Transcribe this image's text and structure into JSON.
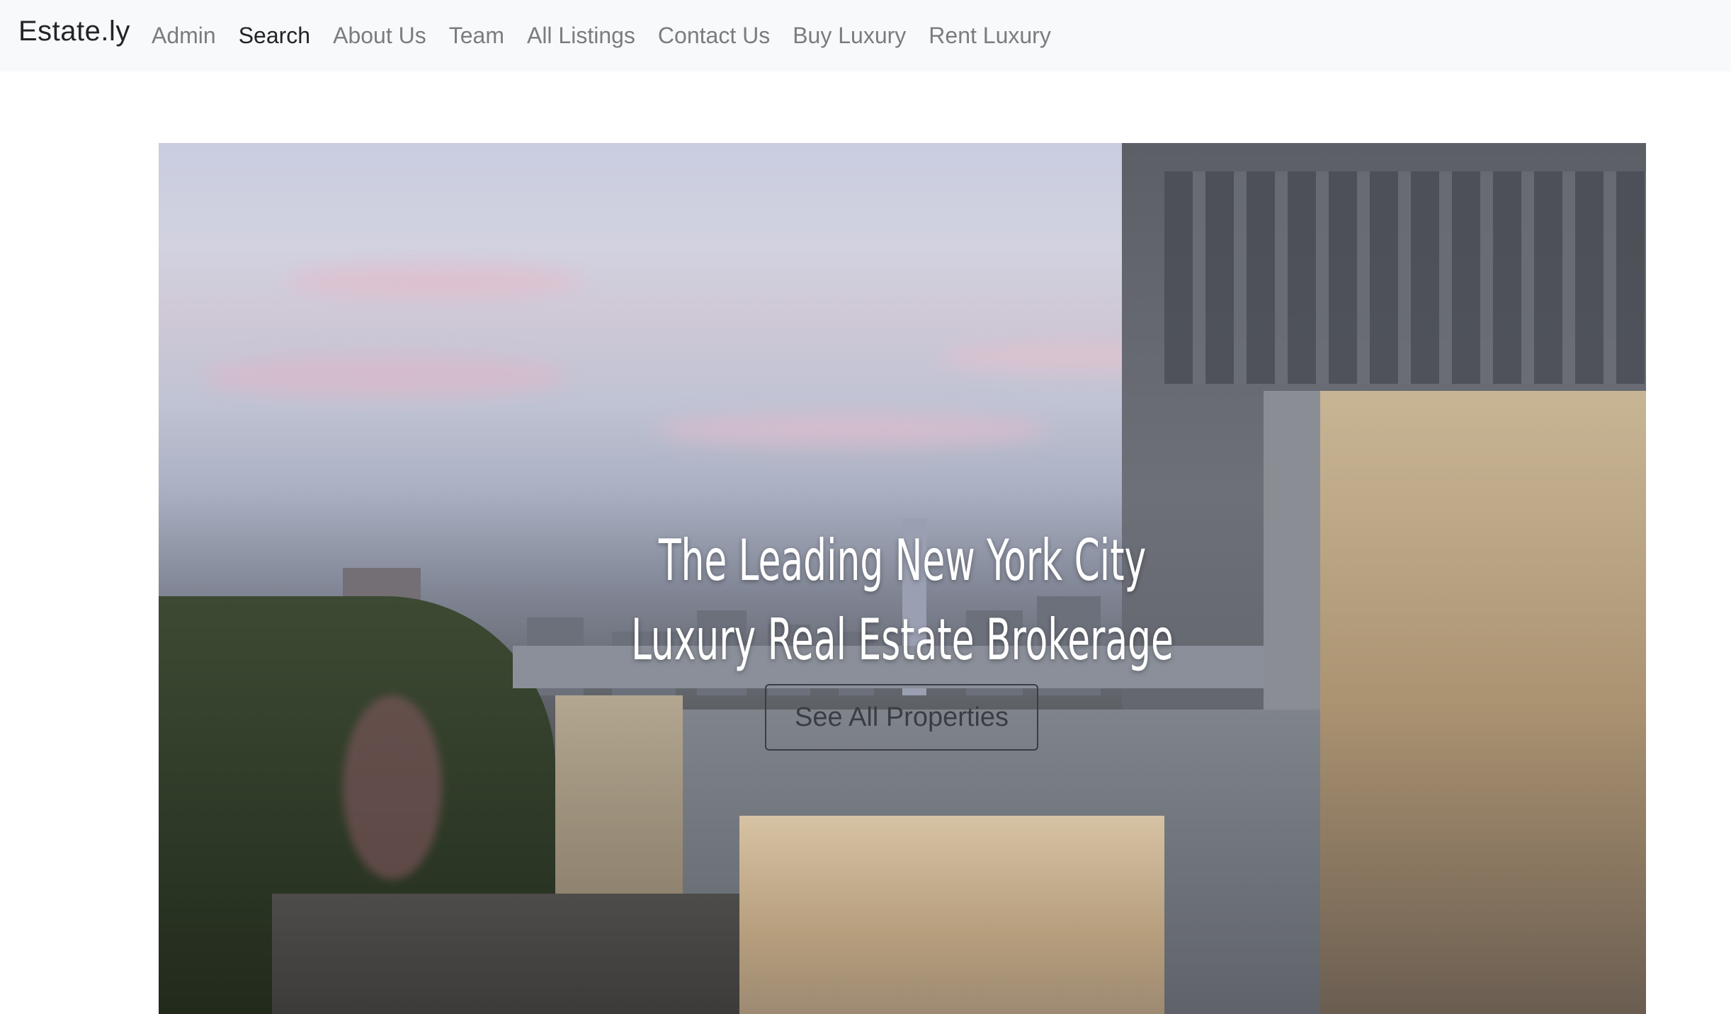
{
  "navbar": {
    "brand": "Estate.ly",
    "items": [
      {
        "label": "Admin",
        "active": false
      },
      {
        "label": "Search",
        "active": true
      },
      {
        "label": "About Us",
        "active": false
      },
      {
        "label": "Team",
        "active": false
      },
      {
        "label": "All Listings",
        "active": false
      },
      {
        "label": "Contact Us",
        "active": false
      },
      {
        "label": "Buy Luxury",
        "active": false
      },
      {
        "label": "Rent Luxury",
        "active": false
      }
    ]
  },
  "hero": {
    "title_line_1": "The Leading New York City",
    "title_line_2": "Luxury Real Estate Brokerage",
    "cta_label": "See All Properties",
    "image_subject": "penthouse-terrace-city-skyline"
  },
  "colors": {
    "navbar_bg": "#f8f9fa",
    "nav_inactive": "#7a7c7e",
    "nav_active": "#212529",
    "hero_text": "#ffffff"
  }
}
